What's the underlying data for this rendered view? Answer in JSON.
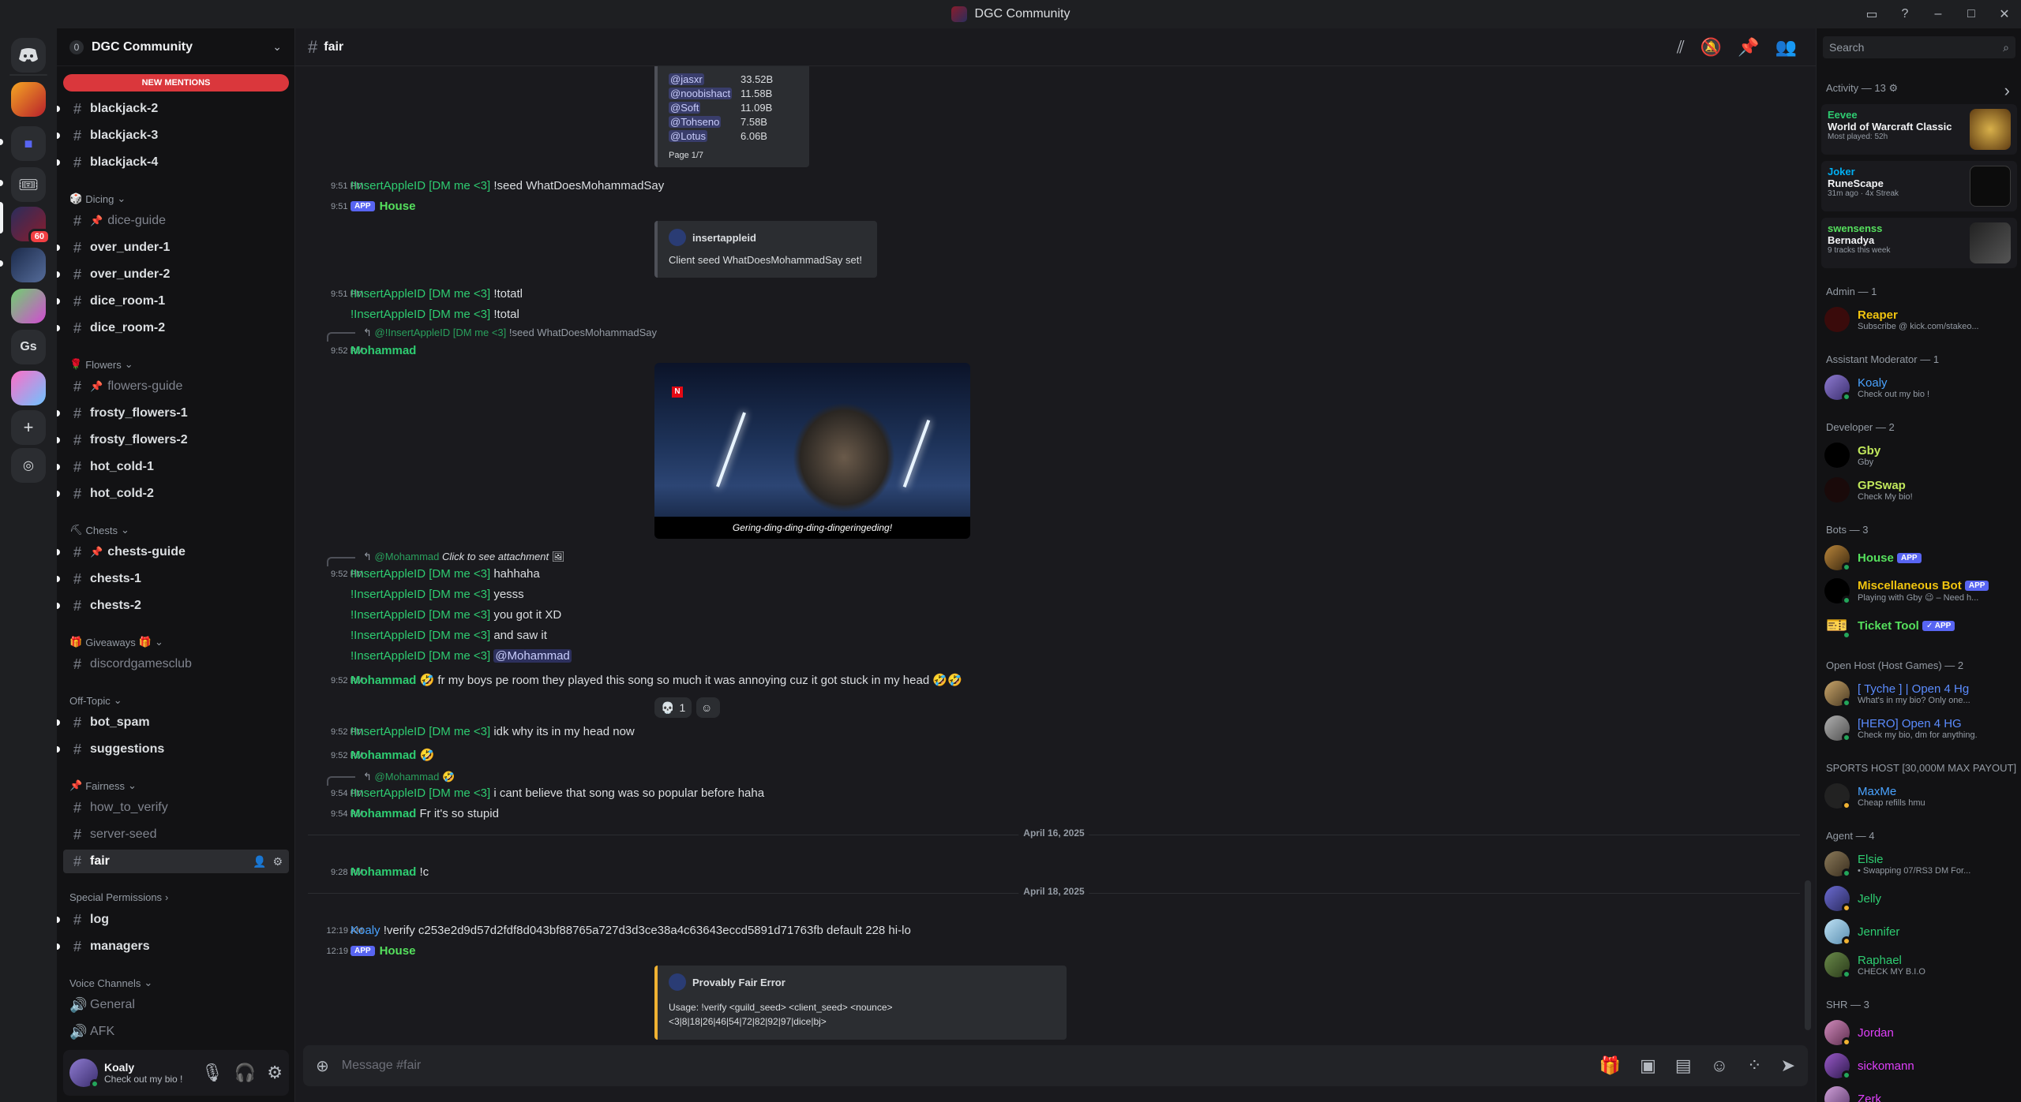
{
  "window": {
    "title": "DGC Community"
  },
  "server": {
    "name": "DGC Community",
    "boost_count": "0",
    "new_mentions": "NEW MENTIONS"
  },
  "rail": {
    "badge": "60",
    "gs_label": "Gs"
  },
  "categories": {
    "dicing": "Dicing",
    "flowers": "Flowers",
    "chests": "Chests",
    "giveaways": "Giveaways",
    "offtopic": "Off-Topic",
    "fairness": "Fairness",
    "special": "Special Permissions",
    "voice": "Voice Channels"
  },
  "channels": [
    "blackjack-2",
    "blackjack-3",
    "blackjack-4",
    "dice-guide",
    "over_under-1",
    "over_under-2",
    "dice_room-1",
    "dice_room-2",
    "flowers-guide",
    "frosty_flowers-1",
    "frosty_flowers-2",
    "hot_cold-1",
    "hot_cold-2",
    "chests-guide",
    "chests-1",
    "chests-2",
    "discordgamesclub",
    "bot_spam",
    "suggestions",
    "how_to_verify",
    "server-seed",
    "fair",
    "log",
    "managers",
    "General",
    "AFK"
  ],
  "user": {
    "name": "Koaly",
    "status": "Check out my bio !"
  },
  "chat": {
    "channel": "fair",
    "composer_placeholder": "Message #fair",
    "leaderboard": [
      {
        "name": "@jasxr",
        "value": "33.52B"
      },
      {
        "name": "@noobishact",
        "value": "11.58B"
      },
      {
        "name": "@Soft",
        "value": "11.09B"
      },
      {
        "name": "@Tohseno",
        "value": "7.58B"
      },
      {
        "name": "@Lotus",
        "value": "6.06B"
      }
    ],
    "page": "Page 1/7",
    "messages": {
      "t1": "9:51 PM",
      "insert": "!InsertAppleID [DM me <3]",
      "seed_cmd": "!seed WhatDoesMohammadSay",
      "house": "House",
      "app": "APP",
      "embed1_user": "insertappleid",
      "embed1_text": "Client seed WhatDoesMohammadSay set!",
      "totatl": "!totatl",
      "total": "!total",
      "reply1_who": "@!InsertAppleID [DM me <3]",
      "reply1_text": "!seed WhatDoesMohammadSay",
      "t2": "9:52 PM",
      "mohammad": "Mohammad",
      "video_caption": "Gering-ding-ding-ding-dingeringeding!",
      "reply2_who": "@Mohammad",
      "reply2_text": "Click to see attachment",
      "hahhaha": "hahhaha",
      "yesss": "yesss",
      "gotit": "you got it XD",
      "saw": "and saw it",
      "mention_moh": "@Mohammad",
      "moh_long": "fr my boys pe room they played this song so much it was annoying cuz it got stuck in my head",
      "react_count": "1",
      "idk": "idk why its in my head now",
      "reply3_who": "@Mohammad",
      "t3": "9:54 PM",
      "cant": "i cant believe that song was so popular before haha",
      "stupid": "Fr it's so stupid",
      "date1": "April 16, 2025",
      "t4": "9:28 PM",
      "c": "!c",
      "date2": "April 18, 2025",
      "t5": "12:19 AM",
      "koaly": "Koaly",
      "verify": "!verify c253e2d9d57d2fdf8d043bf88765a727d3d3ce38a4c63643eccd5891d71763fb default 228 hi-lo",
      "err_title": "Provably Fair Error",
      "err_usage": "Usage: !verify <guild_seed> <client_seed> <nounce>",
      "err_games": "<3|8|18|26|46|54|72|82|92|97|dice|bj>"
    }
  },
  "members": {
    "search_placeholder": "Search",
    "activity_header": "Activity — 13",
    "activity": [
      {
        "who": "Eevee",
        "game": "World of Warcraft Classic",
        "meta": "Most played: 52h"
      },
      {
        "who": "Joker",
        "game": "RuneScape",
        "meta": "31m ago · 4x Streak"
      },
      {
        "who": "swensenss",
        "game": "Bernadya",
        "meta": "9 tracks this week"
      }
    ],
    "groups": {
      "admin": "Admin — 1",
      "asst": "Assistant Moderator — 1",
      "dev": "Developer — 2",
      "bots": "Bots — 3",
      "openhost": "Open Host (Host Games) — 2",
      "sports": "SPORTS HOST [30,000M MAX PAYOUT]",
      "agent": "Agent — 4",
      "shr": "SHR — 3"
    },
    "list": [
      {
        "name": "Reaper",
        "sub": "Subscribe @ kick.com/stakeo..."
      },
      {
        "name": "Koaly",
        "sub": "Check out my bio !"
      },
      {
        "name": "Gby",
        "sub": "Gby"
      },
      {
        "name": "GPSwap",
        "sub": "Check My bio!"
      },
      {
        "name": "House",
        "sub": ""
      },
      {
        "name": "Miscellaneous Bot",
        "sub": "Playing with Gby 😉 – Need h..."
      },
      {
        "name": "Ticket Tool",
        "sub": ""
      },
      {
        "name": "[ Tyche ] | Open 4 Hg",
        "sub": "What's in my bio? Only one..."
      },
      {
        "name": "[HERO] Open 4 HG",
        "sub": "Check my bio, dm for anything."
      },
      {
        "name": "MaxMe",
        "sub": "Cheap refills hmu"
      },
      {
        "name": "Elsie",
        "sub": "• Swapping 07/RS3 DM For..."
      },
      {
        "name": "Jelly",
        "sub": ""
      },
      {
        "name": "Jennifer",
        "sub": ""
      },
      {
        "name": "Raphael",
        "sub": "CHECK MY B.I.O"
      },
      {
        "name": "Jordan",
        "sub": ""
      },
      {
        "name": "sickomann",
        "sub": ""
      },
      {
        "name": "Zerk",
        "sub": ""
      }
    ]
  },
  "colors": {
    "accent": "#5865f2",
    "danger": "#da373c",
    "green": "#2ecc71",
    "house": "#55e05d"
  }
}
